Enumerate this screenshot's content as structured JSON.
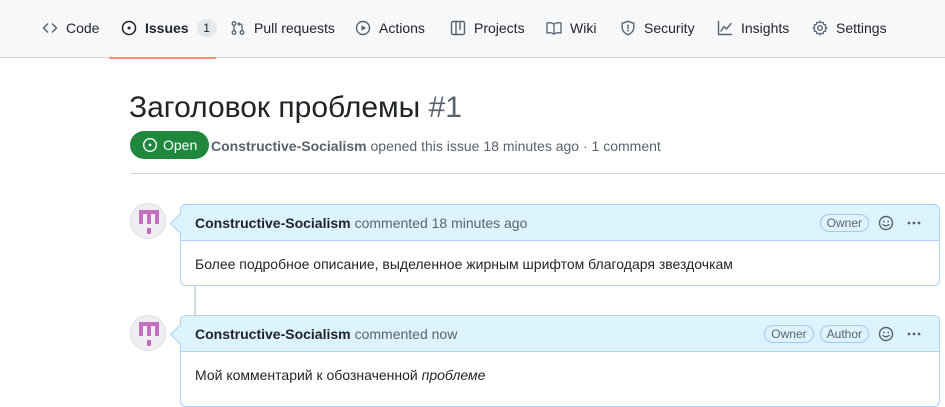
{
  "tabs": [
    {
      "id": "code",
      "label": "Code",
      "icon": "code-icon"
    },
    {
      "id": "issues",
      "label": "Issues",
      "icon": "issue-opened-icon",
      "count": "1",
      "selected": true
    },
    {
      "id": "pulls",
      "label": "Pull requests",
      "icon": "git-pull-request-icon"
    },
    {
      "id": "actions",
      "label": "Actions",
      "icon": "play-icon"
    },
    {
      "id": "projects",
      "label": "Projects",
      "icon": "table-icon"
    },
    {
      "id": "wiki",
      "label": "Wiki",
      "icon": "book-icon"
    },
    {
      "id": "security",
      "label": "Security",
      "icon": "shield-icon"
    },
    {
      "id": "insights",
      "label": "Insights",
      "icon": "graph-icon"
    },
    {
      "id": "settings",
      "label": "Settings",
      "icon": "gear-icon"
    }
  ],
  "issue": {
    "title": "Заголовок проблемы",
    "number": "#1",
    "state": "Open",
    "author": "Constructive-Socialism",
    "opened_text": "opened this issue 18 minutes ago",
    "separator": "·",
    "comments_count": "1 comment"
  },
  "comments": [
    {
      "author": "Constructive-Socialism",
      "action": "commented 18 minutes ago",
      "labels": [
        "Owner"
      ],
      "body_text": "Более подробное описание, выделенное жирным шрифтом благодаря звездочкам",
      "body_emph": ""
    },
    {
      "author": "Constructive-Socialism",
      "action": "commented now",
      "labels": [
        "Owner",
        "Author"
      ],
      "body_text": "Мой комментарий к обозначенной ",
      "body_emph": "проблеме"
    }
  ],
  "colors": {
    "accent_underline": "#fd8c73",
    "open_green": "#1f883d",
    "comment_header_bg": "#ddf4ff",
    "avatar_pink": "#c36fbf"
  }
}
